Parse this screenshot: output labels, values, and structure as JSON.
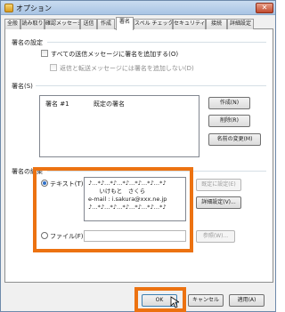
{
  "window": {
    "title": "オプション",
    "close_glyph": "✕"
  },
  "tabs": [
    {
      "label": "全般"
    },
    {
      "label": "読み取り"
    },
    {
      "label": "確認メッセージ"
    },
    {
      "label": "送信"
    },
    {
      "label": "作成"
    },
    {
      "label": "署名",
      "active": true
    },
    {
      "label": "スペル チェック"
    },
    {
      "label": "セキュリティ"
    },
    {
      "label": "接続"
    },
    {
      "label": "詳細設定"
    }
  ],
  "settings": {
    "heading": "署名の設定",
    "add_to_all": "すべての送信メッセージに署名を追加する(O)",
    "skip_replies": "返信と転送メッセージには署名を追加しない(D)"
  },
  "signatures": {
    "heading": "署名(S)",
    "list": [
      {
        "name": "署名 #1",
        "status": "既定の署名"
      }
    ],
    "buttons": {
      "new": "作成(N)",
      "delete": "削除(R)",
      "rename": "名前の変更(M)"
    }
  },
  "edit": {
    "heading": "署名の編集",
    "text_option": "テキスト(T)",
    "file_option": "ファイル(F)",
    "text_value": "♪…*♪…*♪…*♪…*♪…*♪…*♪\n      いけもと　さくら\ne-mail : i.sakura@xxx.ne.jp\n♪…*♪…*♪…*♪…*♪…*♪…*♪",
    "buttons": {
      "set_default": "既定に設定(E)",
      "advanced": "詳細設定(V)...",
      "browse": "参照(W)..."
    }
  },
  "footer": {
    "ok": "OK",
    "cancel": "キャンセル",
    "apply": "適用(A)"
  },
  "accent": "#ec7211"
}
